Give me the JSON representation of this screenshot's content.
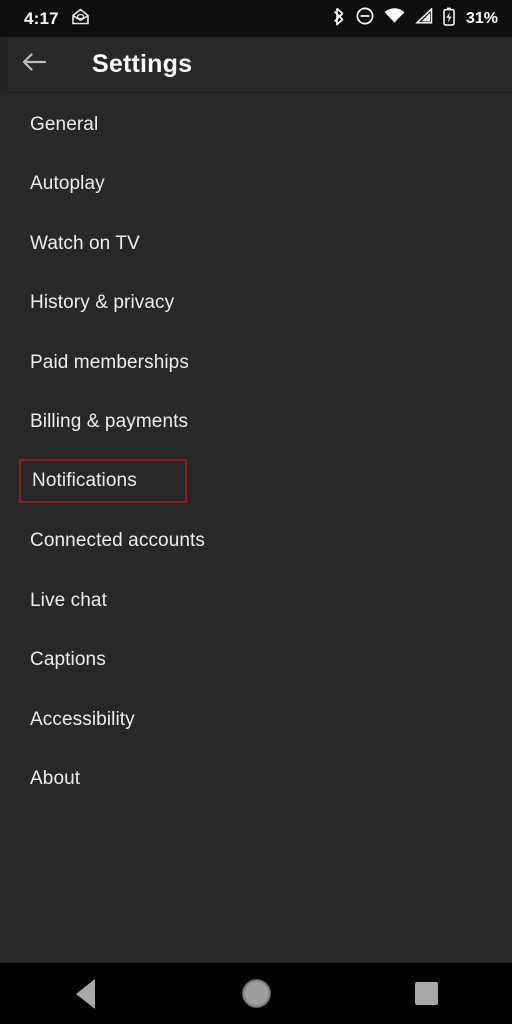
{
  "status_bar": {
    "time": "4:17",
    "battery_percent": "31%",
    "icons": {
      "mail": "mail-icon",
      "bluetooth": "bluetooth-icon",
      "do_not_disturb": "do-not-disturb-icon",
      "wifi": "wifi-icon",
      "cellular": "cellular-signal-icon",
      "battery": "battery-charging-icon"
    }
  },
  "app_bar": {
    "title": "Settings",
    "back_icon": "arrow-left-icon"
  },
  "settings": {
    "items": [
      {
        "label": "General",
        "highlighted": false
      },
      {
        "label": "Autoplay",
        "highlighted": false
      },
      {
        "label": "Watch on TV",
        "highlighted": false
      },
      {
        "label": "History & privacy",
        "highlighted": false
      },
      {
        "label": "Paid memberships",
        "highlighted": false
      },
      {
        "label": "Billing & payments",
        "highlighted": false
      },
      {
        "label": "Notifications",
        "highlighted": true
      },
      {
        "label": "Connected accounts",
        "highlighted": false
      },
      {
        "label": "Live chat",
        "highlighted": false
      },
      {
        "label": "Captions",
        "highlighted": false
      },
      {
        "label": "Accessibility",
        "highlighted": false
      },
      {
        "label": "About",
        "highlighted": false
      }
    ]
  },
  "nav_bar": {
    "back_label": "Back",
    "home_label": "Home",
    "recents_label": "Recents"
  },
  "colors": {
    "highlight_border": "#8f1d1d",
    "background": "#282828",
    "status_bar_bg": "#0e0e0e",
    "nav_bar_bg": "#000000",
    "text": "#ededed"
  }
}
